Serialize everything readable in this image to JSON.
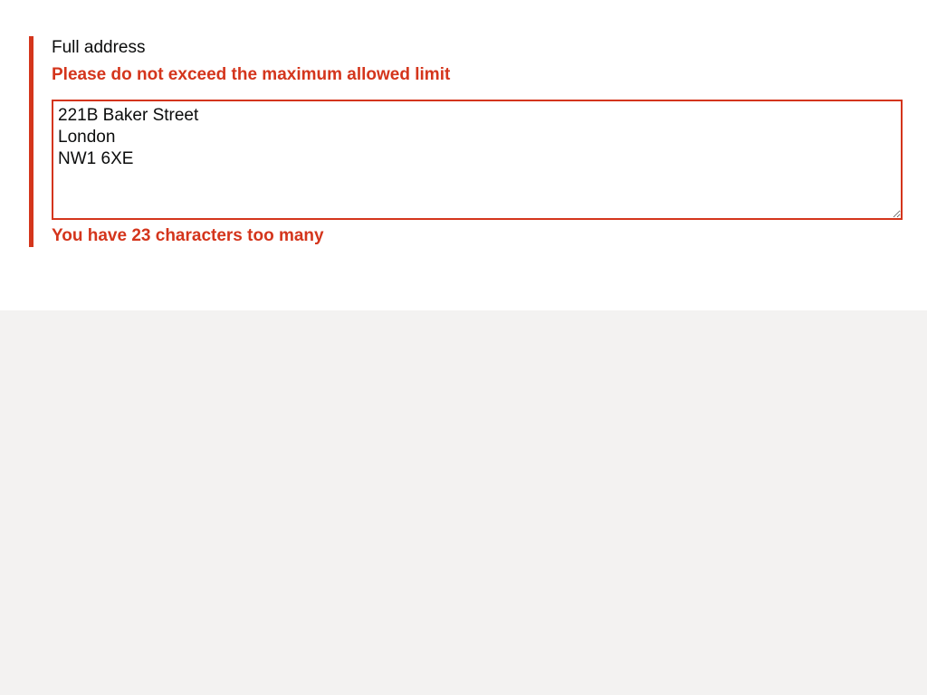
{
  "field": {
    "label": "Full address",
    "error_message": "Please do not exceed the maximum allowed limit",
    "value": "221B Baker Street\nLondon\nNW1 6XE",
    "count_message": "You have 23 characters too many"
  },
  "colors": {
    "error": "#d4351c",
    "text": "#0b0c0c",
    "background": "#ffffff",
    "page_background": "#f3f2f1"
  }
}
